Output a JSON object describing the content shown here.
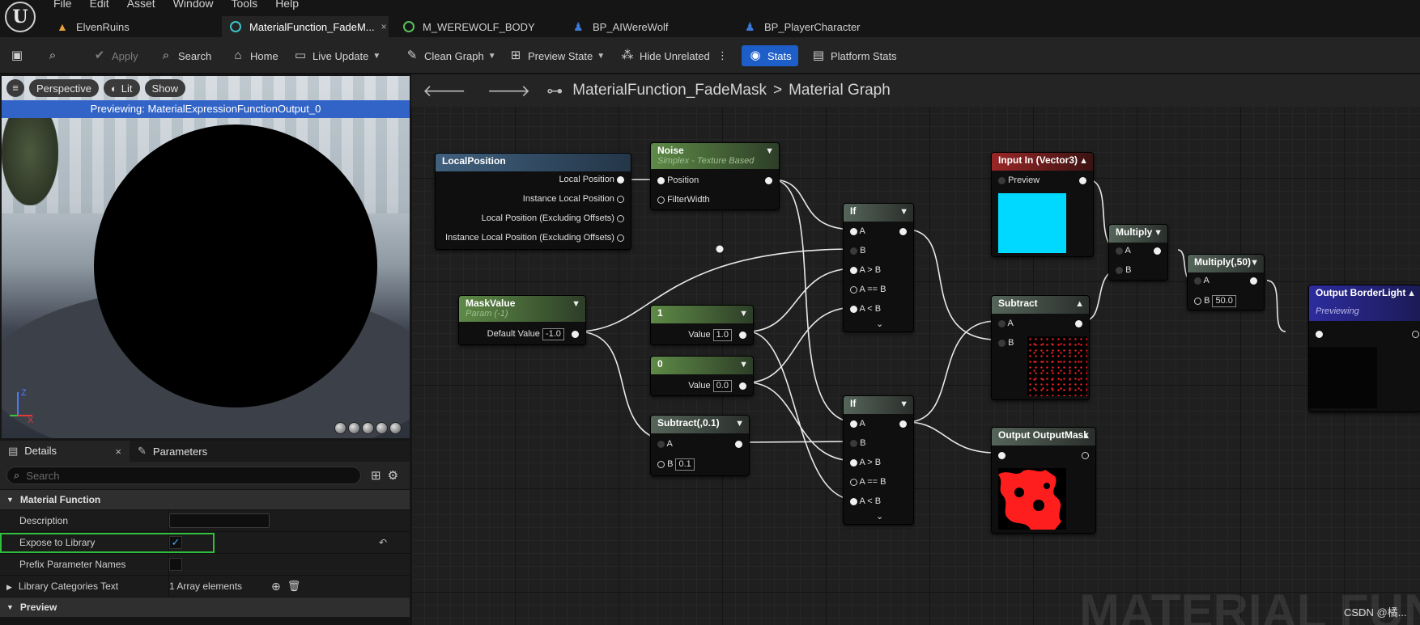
{
  "menu": [
    "File",
    "Edit",
    "Asset",
    "Window",
    "Tools",
    "Help"
  ],
  "tabs": [
    {
      "label": "ElvenRuins"
    },
    {
      "label": "MaterialFunction_FadeM...",
      "close": "×"
    },
    {
      "label": "M_WEREWOLF_BODY"
    },
    {
      "label": "BP_AIWereWolf"
    },
    {
      "label": "BP_PlayerCharacter"
    }
  ],
  "toolbar": {
    "apply": "Apply",
    "search": "Search",
    "home": "Home",
    "live_update": "Live Update",
    "clean_graph": "Clean Graph",
    "preview_state": "Preview State",
    "hide_unrelated": "Hide Unrelated",
    "stats": "Stats",
    "platform_stats": "Platform Stats"
  },
  "viewport": {
    "perspective": "Perspective",
    "lit": "Lit",
    "show": "Show",
    "info": "Previewing: MaterialExpressionFunctionOutput_0",
    "axis_z": "Z",
    "axis_x": "X"
  },
  "details": {
    "tab_details": "Details",
    "tab_close": "×",
    "tab_parameters": "Parameters",
    "search_placeholder": "Search",
    "category_material_function": "Material Function",
    "rows": [
      {
        "name": "Description",
        "value": ""
      },
      {
        "name": "Expose to Library",
        "value": "✓"
      },
      {
        "name": "Prefix Parameter Names",
        "value": ""
      },
      {
        "name": "Library Categories Text",
        "value": "1 Array elements"
      }
    ],
    "category_preview": "Preview"
  },
  "graph": {
    "breadcrumb_function": "MaterialFunction_FadeMask",
    "breadcrumb_sep": ">",
    "breadcrumb_graph": "Material Graph",
    "watermark": "MATERIAL FUNC",
    "credit": "CSDN @橘..."
  },
  "nodes": {
    "local_position": {
      "title": "LocalPosition",
      "pins": [
        "Local Position",
        "Instance Local Position",
        "Local Position (Excluding Offsets)",
        "Instance Local Position (Excluding Offsets)"
      ]
    },
    "noise": {
      "title": "Noise",
      "subtitle": "Simplex - Texture Based",
      "pins": [
        "Position",
        "FilterWidth"
      ]
    },
    "mask_value": {
      "title": "MaskValue",
      "subtitle": "Param (-1)",
      "pin": "Default Value",
      "value": "-1.0"
    },
    "const_1": {
      "title": "1",
      "pin": "Value",
      "value": "1.0"
    },
    "const_0": {
      "title": "0",
      "pin": "Value",
      "value": "0.0"
    },
    "subtract_01": {
      "title": "Subtract(,0.1)",
      "pin_a": "A",
      "pin_b": "B",
      "value_b": "0.1"
    },
    "if_top": {
      "title": "If",
      "pins": [
        "A",
        "B",
        "A > B",
        "A == B",
        "A < B"
      ]
    },
    "if_bottom": {
      "title": "If",
      "pins": [
        "A",
        "B",
        "A > B",
        "A == B",
        "A < B"
      ]
    },
    "input_in": {
      "title": "Input In (Vector3)",
      "pin": "Preview"
    },
    "subtract": {
      "title": "Subtract",
      "pin_a": "A",
      "pin_b": "B"
    },
    "output_mask": {
      "title": "Output OutputMask"
    },
    "multiply": {
      "title": "Multiply",
      "pin_a": "A",
      "pin_b": "B"
    },
    "multiply_50": {
      "title": "Multiply(,50)",
      "pin_a": "A",
      "pin_b": "B",
      "value_b": "50.0"
    },
    "output_border": {
      "title": "Output BorderLight",
      "subtitle": "Previewing"
    }
  }
}
